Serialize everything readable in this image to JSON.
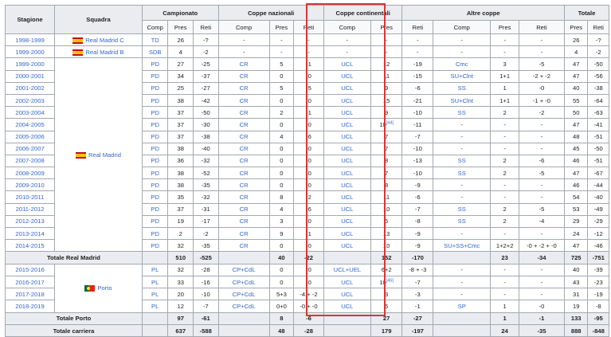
{
  "headers": {
    "stagione": "Stagione",
    "squadra": "Squadra",
    "campionato": "Campionato",
    "coppe_nazionali": "Coppe nazionali",
    "coppe_continentali": "Coppe continentali",
    "altre_coppe": "Altre coppe",
    "totale": "Totale",
    "comp": "Comp",
    "pres": "Pres",
    "reti": "Reti"
  },
  "teams": {
    "rmc": "Real Madrid C",
    "rmb": "Real Madrid B",
    "rm": "Real Madrid",
    "porto": "Porto"
  },
  "flags": {
    "spain": "flag-spain-icon",
    "portugal": "flag-portugal-icon"
  },
  "highlight_color": "#dd3333",
  "rows": [
    {
      "season": "1998-1999",
      "cc": "TD",
      "cp": "26",
      "cr": "-?",
      "nc": "-",
      "np": "-",
      "nr": "-",
      "ic": "-",
      "ip": "-",
      "ir": "-",
      "oc": "-",
      "op": "-",
      "or": "-",
      "tp": "26",
      "tr": "-?"
    },
    {
      "season": "1999-2000",
      "cc": "SDB",
      "cp": "4",
      "cr": "-2",
      "nc": "-",
      "np": "-",
      "nr": "-",
      "ic": "-",
      "ip": "-",
      "ir": "-",
      "oc": "-",
      "op": "-",
      "or": "-",
      "tp": "4",
      "tr": "-2"
    },
    {
      "season": "1999-2000",
      "cc": "PD",
      "cp": "27",
      "cr": "-25",
      "nc": "CR",
      "np": "5",
      "nr": "-1",
      "ic": "UCL",
      "ip": "12",
      "ir": "-19",
      "oc": "Cmc",
      "op": "3",
      "or": "-5",
      "tp": "47",
      "tr": "-50"
    },
    {
      "season": "2000-2001",
      "cc": "PD",
      "cp": "34",
      "cr": "-37",
      "nc": "CR",
      "np": "0",
      "nr": "-0",
      "ic": "UCL",
      "ip": "11",
      "ir": "-15",
      "oc": "SU+Clnt",
      "op": "1+1",
      "or": "-2 + -2",
      "tp": "47",
      "tr": "-56"
    },
    {
      "season": "2001-2002",
      "cc": "PD",
      "cp": "25",
      "cr": "-27",
      "nc": "CR",
      "np": "5",
      "nr": "-5",
      "ic": "UCL",
      "ip": "9",
      "ir": "-6",
      "oc": "SS",
      "op": "1",
      "or": "-0",
      "tp": "40",
      "tr": "-38"
    },
    {
      "season": "2002-2003",
      "cc": "PD",
      "cp": "38",
      "cr": "-42",
      "nc": "CR",
      "np": "0",
      "nr": "-0",
      "ic": "UCL",
      "ip": "15",
      "ir": "-21",
      "oc": "SU+Clnt",
      "op": "1+1",
      "or": "-1 + -0",
      "tp": "55",
      "tr": "-64"
    },
    {
      "season": "2003-2004",
      "cc": "PD",
      "cp": "37",
      "cr": "-50",
      "nc": "CR",
      "np": "2",
      "nr": "-1",
      "ic": "UCL",
      "ip": "9",
      "ir": "-10",
      "oc": "SS",
      "op": "2",
      "or": "-2",
      "tp": "50",
      "tr": "-63"
    },
    {
      "season": "2004-2005",
      "cc": "PD",
      "cp": "37",
      "cr": "-30",
      "nc": "CR",
      "np": "0",
      "nr": "-0",
      "ic": "UCL",
      "ip": "10",
      "sup": "[44]",
      "ir": "-11",
      "oc": "-",
      "op": "-",
      "or": "-",
      "tp": "47",
      "tr": "-41"
    },
    {
      "season": "2005-2006",
      "cc": "PD",
      "cp": "37",
      "cr": "-38",
      "nc": "CR",
      "np": "4",
      "nr": "-6",
      "ic": "UCL",
      "ip": "7",
      "ir": "-7",
      "oc": "-",
      "op": "-",
      "or": "-",
      "tp": "48",
      "tr": "-51"
    },
    {
      "season": "2006-2007",
      "cc": "PD",
      "cp": "38",
      "cr": "-40",
      "nc": "CR",
      "np": "0",
      "nr": "-0",
      "ic": "UCL",
      "ip": "7",
      "ir": "-10",
      "oc": "-",
      "op": "-",
      "or": "-",
      "tp": "45",
      "tr": "-50"
    },
    {
      "season": "2007-2008",
      "cc": "PD",
      "cp": "36",
      "cr": "-32",
      "nc": "CR",
      "np": "0",
      "nr": "-0",
      "ic": "UCL",
      "ip": "8",
      "ir": "-13",
      "oc": "SS",
      "op": "2",
      "or": "-6",
      "tp": "46",
      "tr": "-51"
    },
    {
      "season": "2008-2009",
      "cc": "PD",
      "cp": "38",
      "cr": "-52",
      "nc": "CR",
      "np": "0",
      "nr": "-0",
      "ic": "UCL",
      "ip": "7",
      "ir": "-10",
      "oc": "SS",
      "op": "2",
      "or": "-5",
      "tp": "47",
      "tr": "-67"
    },
    {
      "season": "2009-2010",
      "cc": "PD",
      "cp": "38",
      "cr": "-35",
      "nc": "CR",
      "np": "0",
      "nr": "-0",
      "ic": "UCL",
      "ip": "8",
      "ir": "-9",
      "oc": "-",
      "op": "-",
      "or": "-",
      "tp": "46",
      "tr": "-44"
    },
    {
      "season": "2010-2011",
      "cc": "PD",
      "cp": "35",
      "cr": "-32",
      "nc": "CR",
      "np": "8",
      "nr": "-2",
      "ic": "UCL",
      "ip": "11",
      "ir": "-6",
      "oc": "-",
      "op": "-",
      "or": "-",
      "tp": "54",
      "tr": "-40"
    },
    {
      "season": "2011-2012",
      "cc": "PD",
      "cp": "37",
      "cr": "-31",
      "nc": "CR",
      "np": "4",
      "nr": "-6",
      "ic": "UCL",
      "ip": "10",
      "ir": "-7",
      "oc": "SS",
      "op": "2",
      "or": "-5",
      "tp": "53",
      "tr": "-49"
    },
    {
      "season": "2012-2013",
      "cc": "PD",
      "cp": "19",
      "cr": "-17",
      "nc": "CR",
      "np": "3",
      "nr": "-0",
      "ic": "UCL",
      "ip": "5",
      "ir": "-8",
      "oc": "SS",
      "op": "2",
      "or": "-4",
      "tp": "29",
      "tr": "-29"
    },
    {
      "season": "2013-2014",
      "cc": "PD",
      "cp": "2",
      "cr": "-2",
      "nc": "CR",
      "np": "9",
      "nr": "-1",
      "ic": "UCL",
      "ip": "13",
      "ir": "-9",
      "oc": "-",
      "op": "-",
      "or": "-",
      "tp": "24",
      "tr": "-12"
    },
    {
      "season": "2014-2015",
      "cc": "PD",
      "cp": "32",
      "cr": "-35",
      "nc": "CR",
      "np": "0",
      "nr": "-0",
      "ic": "UCL",
      "ip": "10",
      "ir": "-9",
      "oc": "SU+SS+Cmc",
      "op": "1+2+2",
      "or": "-0 + -2 + -0",
      "tp": "47",
      "tr": "-46"
    },
    {
      "season": "2015-2016",
      "cc": "PL",
      "cp": "32",
      "cr": "-28",
      "nc": "CP+CdL",
      "np": "0",
      "nr": "-0",
      "ic": "UCL+UEL",
      "ip": "6+2",
      "ir": "-8 + -3",
      "oc": "-",
      "op": "-",
      "or": "-",
      "tp": "40",
      "tr": "-39"
    },
    {
      "season": "2016-2017",
      "cc": "PL",
      "cp": "33",
      "cr": "-16",
      "nc": "CP+CdL",
      "np": "0",
      "nr": "-0",
      "ic": "UCL",
      "ip": "10",
      "sup": "[45]",
      "ir": "-7",
      "oc": "-",
      "op": "-",
      "or": "-",
      "tp": "43",
      "tr": "-23"
    },
    {
      "season": "2017-2018",
      "cc": "PL",
      "cp": "20",
      "cr": "-10",
      "nc": "CP+CdL",
      "np": "5+3",
      "nr": "-4 + -2",
      "ic": "UCL",
      "ip": "3",
      "ir": "-3",
      "oc": "-",
      "op": "-",
      "or": "-",
      "tp": "31",
      "tr": "-19"
    },
    {
      "season": "2018-2019",
      "cc": "PL",
      "cp": "12",
      "cr": "-7",
      "nc": "CP+CdL",
      "np": "0+0",
      "nr": "-0 + -0",
      "ic": "UCL",
      "ip": "6",
      "ir": "-1",
      "oc": "SP",
      "op": "1",
      "or": "-0",
      "tp": "19",
      "tr": "-8"
    }
  ],
  "totals": {
    "rm": {
      "label": "Totale Real Madrid",
      "cp": "510",
      "cr": "-525",
      "np": "40",
      "nr": "-22",
      "ip": "152",
      "ir": "-170",
      "op": "23",
      "or": "-34",
      "tp": "725",
      "tr": "-751"
    },
    "porto": {
      "label": "Totale Porto",
      "cp": "97",
      "cr": "-61",
      "np": "8",
      "nr": "-6",
      "ip": "27",
      "ir": "-27",
      "op": "1",
      "or": "-1",
      "tp": "133",
      "tr": "-95"
    },
    "career": {
      "label": "Totale carriera",
      "cp": "637",
      "cr": "-588",
      "np": "48",
      "nr": "-28",
      "ip": "179",
      "ir": "-197",
      "op": "24",
      "or": "-35",
      "tp": "888",
      "tr": "-848"
    }
  }
}
